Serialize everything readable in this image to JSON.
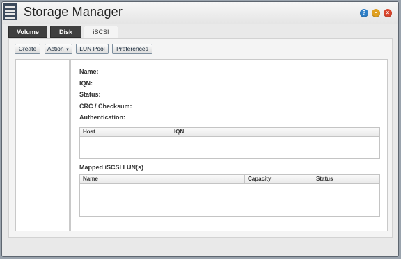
{
  "window": {
    "title": "Storage Manager",
    "buttons": [
      {
        "name": "help",
        "glyph": "?",
        "color": "#2f7fc7"
      },
      {
        "name": "minimize",
        "glyph": "–",
        "color": "#e0a020"
      },
      {
        "name": "close",
        "glyph": "×",
        "color": "#d8452c"
      }
    ]
  },
  "tabs": [
    {
      "label": "Volume",
      "active": false
    },
    {
      "label": "Disk",
      "active": false
    },
    {
      "label": "iSCSI",
      "active": true
    }
  ],
  "toolbar": {
    "create_label": "Create",
    "action_label": "Action",
    "lun_pool_label": "LUN Pool",
    "preferences_label": "Preferences"
  },
  "details": {
    "name_label": "Name:",
    "iqn_label": "IQN:",
    "status_label": "Status:",
    "crc_label": "CRC / Checksum:",
    "auth_label": "Authentication:"
  },
  "hosts_table": {
    "columns": [
      "Host",
      "IQN"
    ],
    "rows": []
  },
  "mapped_luns": {
    "title": "Mapped iSCSI LUN(s)",
    "columns": [
      "Name",
      "Capacity",
      "Status"
    ],
    "rows": []
  }
}
